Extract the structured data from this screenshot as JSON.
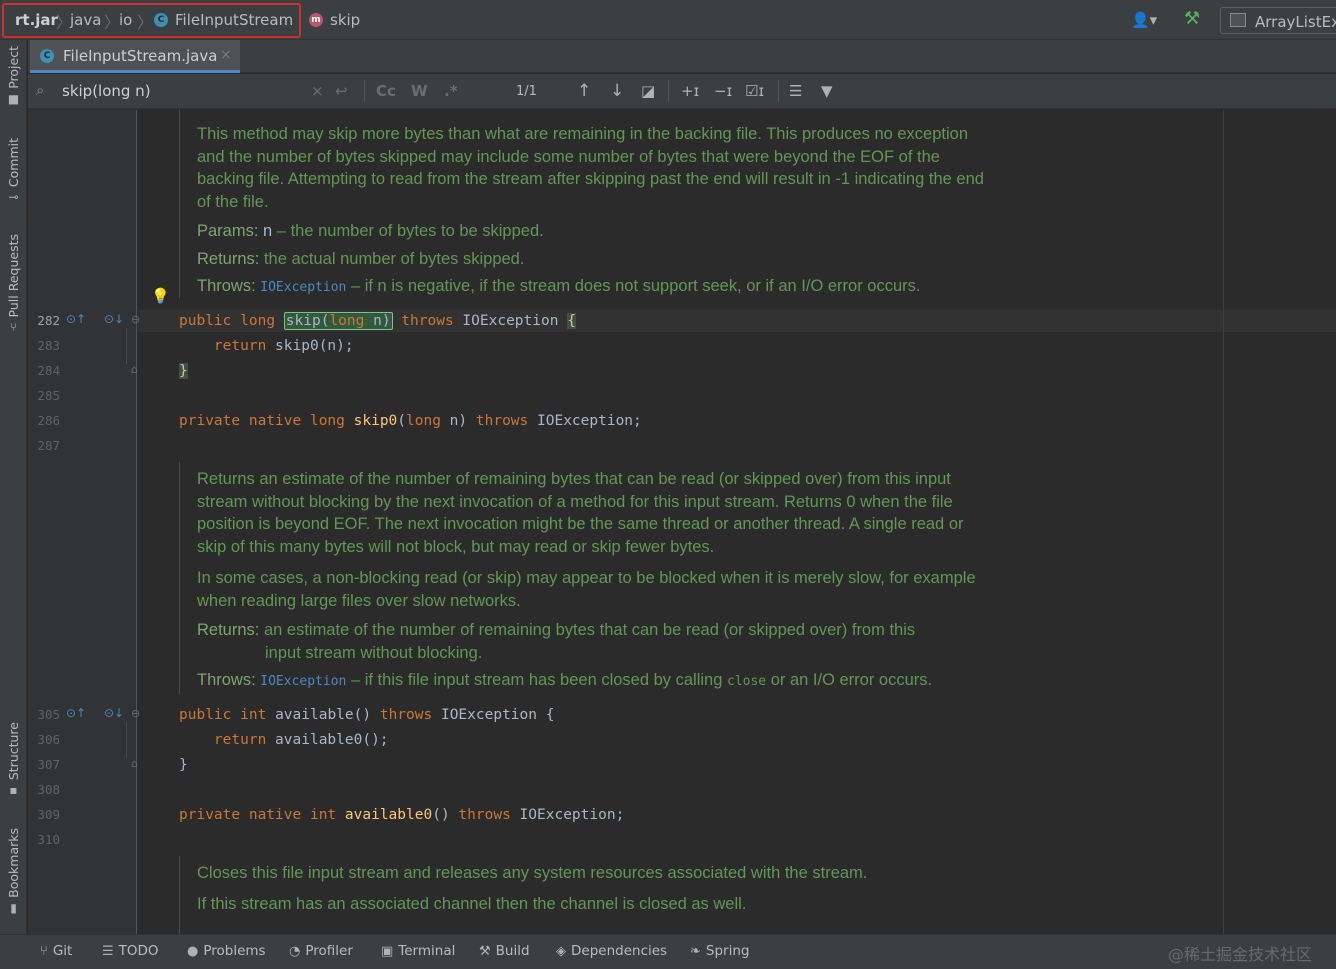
{
  "navbar": {
    "breadcrumbs": [
      "rt.jar",
      "java",
      "io",
      "FileInputStream",
      "skip"
    ],
    "class_icon_letter": "C",
    "method_icon_letter": "m",
    "run_config": "ArrayListEx",
    "colors": {
      "highlight_border": "#c8312f",
      "build_icon": "#5fb35f"
    }
  },
  "left_tools": [
    "Project",
    "Commit",
    "Pull Requests",
    "Structure",
    "Bookmarks"
  ],
  "tabs": [
    {
      "label": "FileInputStream.java",
      "active": true
    }
  ],
  "find": {
    "query": "skip(long n)",
    "case_label": "Cc",
    "word_label": "W",
    "regex_label": ".*",
    "count": "1/1"
  },
  "gutter": {
    "lines": [
      "282",
      "283",
      "284",
      "285",
      "286",
      "287",
      "305",
      "306",
      "307",
      "308",
      "309",
      "310"
    ]
  },
  "doc1": {
    "p1": "This method may skip more bytes than what are remaining in the backing file. This produces no exception and the number of bytes skipped may include some number of bytes that were beyond the EOF of the backing file. Attempting to read from the stream after skipping past the end will result in -1 indicating the end of the file.",
    "params_tag": "Params:",
    "params_name": "n",
    "params_desc": " – the number of bytes to be skipped.",
    "returns_tag": "Returns:",
    "returns_desc": "the actual number of bytes skipped.",
    "throws_tag": "Throws:",
    "throws_link": "IOException",
    "throws_desc": " – if n is negative, if the stream does not support seek, or if an I/O error occurs."
  },
  "code1": {
    "l282_public": "public",
    "l282_long": "long",
    "l282_skip": "skip(",
    "l282_long2": "long",
    "l282_n": " n)",
    "l282_throws": "throws",
    "l282_exc": "IOException",
    "l282_brace": "{",
    "l283_return": "return",
    "l283_call": "skip0(n);",
    "l284_brace": "}",
    "l286_private": "private",
    "l286_native": "native",
    "l286_long": "long",
    "l286_fn": "skip0",
    "l286_open": "(",
    "l286_long2": "long",
    "l286_n": " n)",
    "l286_throws": "throws",
    "l286_exc": "IOException;"
  },
  "doc2": {
    "p1": "Returns an estimate of the number of remaining bytes that can be read (or skipped over) from this input stream without blocking by the next invocation of a method for this input stream. Returns 0 when the file position is beyond EOF. The next invocation might be the same thread or another thread. A single read or skip of this many bytes will not block, but may read or skip fewer bytes.",
    "p2": "In some cases, a non-blocking read (or skip) may appear to be blocked when it is merely slow, for example when reading large files over slow networks.",
    "returns_tag": "Returns:",
    "returns_desc_1": "an estimate of the number of remaining bytes that can be read (or skipped over) from this",
    "returns_desc_2": "input stream without blocking.",
    "throws_tag": "Throws:",
    "throws_link": "IOException",
    "throws_desc_a": " – if this file input stream has been closed by calling ",
    "throws_code": "close",
    "throws_desc_b": " or an I/O error occurs."
  },
  "code2": {
    "l305_public": "public",
    "l305_int": "int",
    "l305_fn": "available",
    "l305_paren": "()",
    "l305_throws": "throws",
    "l305_exc": "IOException {",
    "l306_return": "return",
    "l306_call": "available0();",
    "l307_brace": "}",
    "l309_private": "private",
    "l309_native": "native",
    "l309_int": "int",
    "l309_fn": "available0",
    "l309_paren": "()",
    "l309_throws": "throws",
    "l309_exc": "IOException;"
  },
  "doc3": {
    "p1": "Closes this file input stream and releases any system resources associated with the stream.",
    "p2": "If this stream has an associated channel then the channel is closed as well."
  },
  "bottom_tools": [
    "Git",
    "TODO",
    "Problems",
    "Profiler",
    "Terminal",
    "Build",
    "Dependencies",
    "Spring"
  ],
  "watermark": "@稀土掘金技术社区"
}
